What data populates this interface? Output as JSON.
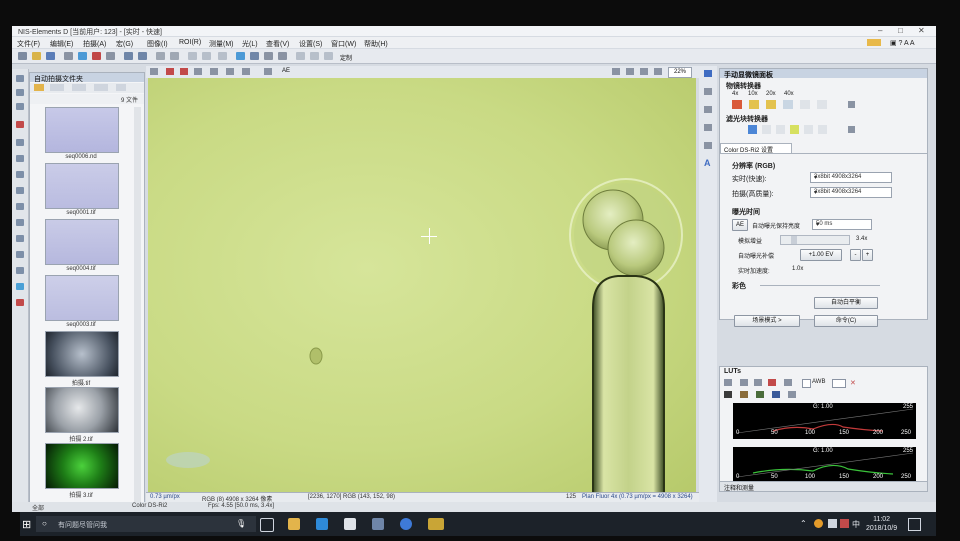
{
  "window": {
    "title": "NIS-Elements D [当前用户: 123] - [实时 - 快速]"
  },
  "menu": [
    "文件(F)",
    "编辑(E)",
    "拍摄(A)",
    "宏(G)",
    "图像(I)",
    "ROI(R)",
    "测量(M)",
    "光(L)",
    "查看(V)",
    "设置(S)",
    "窗口(W)",
    "帮助(H)"
  ],
  "toolbar": {
    "zoom": "22%",
    "setup_label": "定制",
    "ae_label": "AE"
  },
  "folder_panel": {
    "title": "自动拍摄文件夹",
    "sort_label": "9 文件",
    "thumbs": [
      {
        "label": "seq0006.nd"
      },
      {
        "label": "seq0001.tif"
      },
      {
        "label": "seq0004.tif"
      },
      {
        "label": "seq0003.tif"
      },
      {
        "label": "拍摄.tif"
      },
      {
        "label": "拍摄 2.tif"
      },
      {
        "label": "拍摄 3.tif"
      }
    ]
  },
  "right_panel": {
    "title": "手动显微镜面板",
    "objective_label": "物镜转换器",
    "objectives": [
      "4x",
      "10x",
      "20x",
      "40x"
    ],
    "filter_label": "滤光块转换器",
    "camera_tab": "Color DS-Ri2 设置",
    "resolution_header": "分辨率 (RGB)",
    "fast_label": "实时(快速):",
    "fast_value": "3x8bit 4908x3264",
    "quality_label": "拍摄(高质量):",
    "quality_value": "3x8bit 4908x3264",
    "exposure_header": "曝光时间",
    "ae_button": "AE",
    "auto_exposure_label": "自动曝光保持亮度",
    "exposure_value": "50 ms",
    "gain_label": "模拟增益",
    "gain_value": "3.4x",
    "auto_exposure_comp_label": "自动曝光补偿",
    "ev_value": "+1.00 EV",
    "live_speed_label": "实时加速度:",
    "live_speed_value": "1.0x",
    "color_header": "彩色",
    "awb_button": "自动白平衡",
    "scene_button": "场景模式 >",
    "command_button": "命令(C)"
  },
  "lut_panel": {
    "title": "LUTs",
    "awb_label": "AWB",
    "hist1": {
      "gamma": "G: 1.00",
      "max": "255",
      "ticks": [
        "0",
        "50",
        "100",
        "150",
        "200",
        "250"
      ]
    },
    "hist2": {
      "gamma": "G: 1.00",
      "max": "255",
      "ticks": [
        "0",
        "50",
        "100",
        "150",
        "200",
        "250"
      ]
    },
    "footer": "注释和测量"
  },
  "status": {
    "scale": "0.73 µm/px",
    "image_info": "RGB (8) 4908 x 3264 像素",
    "pixel_info": "[2236, 1270] RGB (143, 152, 98)",
    "page": "125",
    "objective_info": "Plan Fluor 4x (0.73 µm/px = 4908 x 3264)",
    "fps": "Fps: 4.55 [50.0 ms, 3.4x]",
    "camera": "Color DS-Ri2",
    "all": "全部"
  },
  "taskbar": {
    "search_placeholder": "有问题尽管问我",
    "clock_time": "11:02",
    "clock_date": "2018/10/9",
    "ime": "中"
  }
}
